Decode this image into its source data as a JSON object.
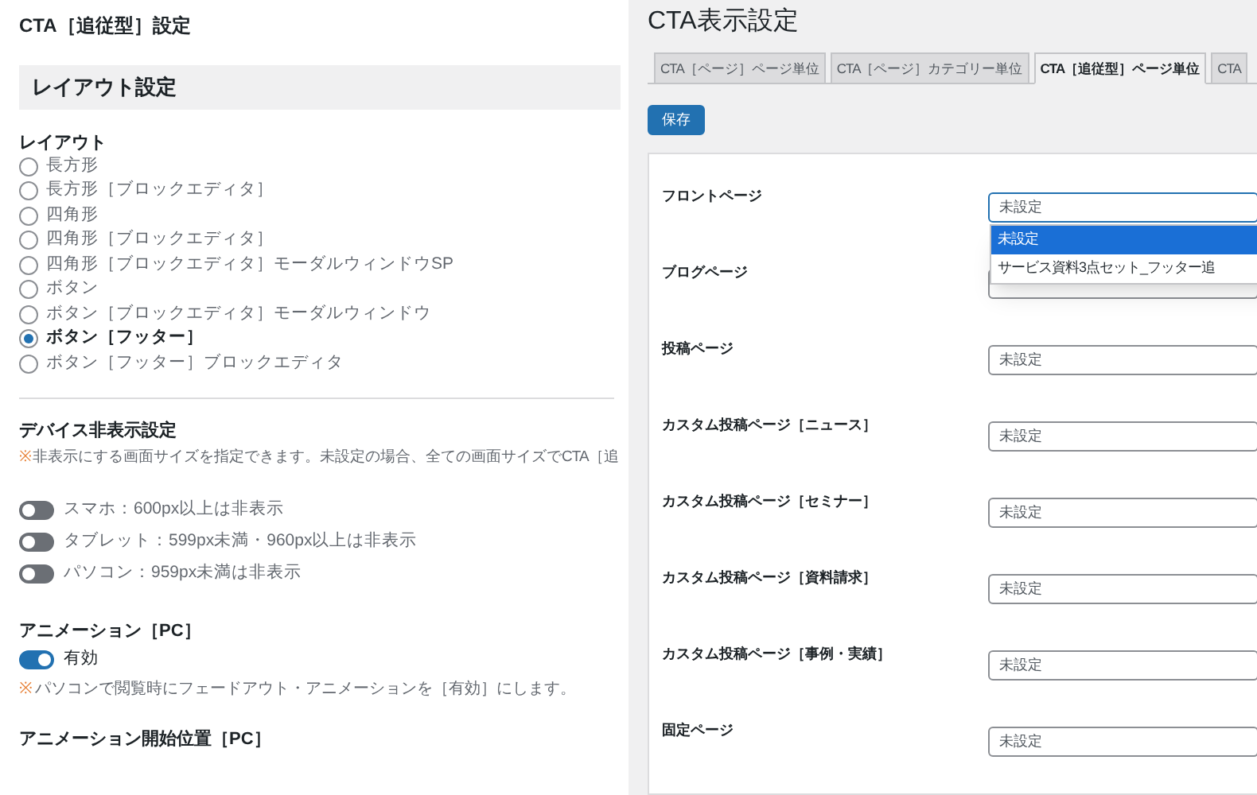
{
  "left": {
    "title": "CTA［追従型］設定",
    "section_header": "レイアウト設定",
    "layout": {
      "label": "レイアウト",
      "options": [
        {
          "label": "長方形",
          "selected": false
        },
        {
          "label": "長方形［ブロックエディタ］",
          "selected": false
        },
        {
          "label": "四角形",
          "selected": false
        },
        {
          "label": "四角形［ブロックエディタ］",
          "selected": false
        },
        {
          "label": "四角形［ブロックエディタ］モーダルウィンドウSP",
          "selected": false
        },
        {
          "label": "ボタン",
          "selected": false
        },
        {
          "label": "ボタン［ブロックエディタ］モーダルウィンドウ",
          "selected": false
        },
        {
          "label": "ボタン［フッター］",
          "selected": true
        },
        {
          "label": "ボタン［フッター］ブロックエディタ",
          "selected": false
        }
      ]
    },
    "device": {
      "label": "デバイス非表示設定",
      "note_mark": "※",
      "note": "非表示にする画面サイズを指定できます。未設定の場合、全ての画面サイズでCTA［追",
      "toggles": [
        {
          "label": "スマホ：600px以上は非表示",
          "on": false
        },
        {
          "label": "タブレット：599px未満・960px以上は非表示",
          "on": false
        },
        {
          "label": "パソコン：959px未満は非表示",
          "on": false
        }
      ]
    },
    "animation": {
      "label": "アニメーション［PC］",
      "toggle": {
        "label": "有効",
        "on": true
      },
      "note_mark": "※",
      "note": "パソコンで閲覧時にフェードアウト・アニメーションを［有効］にします。"
    },
    "animation_start": {
      "label": "アニメーション開始位置［PC］"
    }
  },
  "right": {
    "title": "CTA表示設定",
    "tabs": [
      {
        "label": "CTA［ページ］ページ単位",
        "selected": false
      },
      {
        "label": "CTA［ページ］カテゴリー単位",
        "selected": false
      },
      {
        "label": "CTA［追従型］ページ単位",
        "selected": true
      },
      {
        "label": "CTA",
        "selected": false
      }
    ],
    "save_button": "保存",
    "rows": [
      {
        "label": "フロントページ",
        "value": "未設定",
        "focused": true
      },
      {
        "label": "ブログページ",
        "focused": false
      },
      {
        "label": "投稿ページ",
        "value": "未設定",
        "focused": false
      },
      {
        "label": "カスタム投稿ページ［ニュース］",
        "value": "未設定",
        "focused": false
      },
      {
        "label": "カスタム投稿ページ［セミナー］",
        "value": "未設定",
        "focused": false
      },
      {
        "label": "カスタム投稿ページ［資料請求］",
        "value": "未設定",
        "focused": false
      },
      {
        "label": "カスタム投稿ページ［事例・実績］",
        "value": "未設定",
        "focused": false
      },
      {
        "label": "固定ページ",
        "value": "未設定",
        "focused": false
      }
    ],
    "dropdown": {
      "options": [
        {
          "label": "未設定",
          "selected": true
        },
        {
          "label": "サービス資料3点セット_フッター追",
          "selected": false
        }
      ]
    }
  }
}
